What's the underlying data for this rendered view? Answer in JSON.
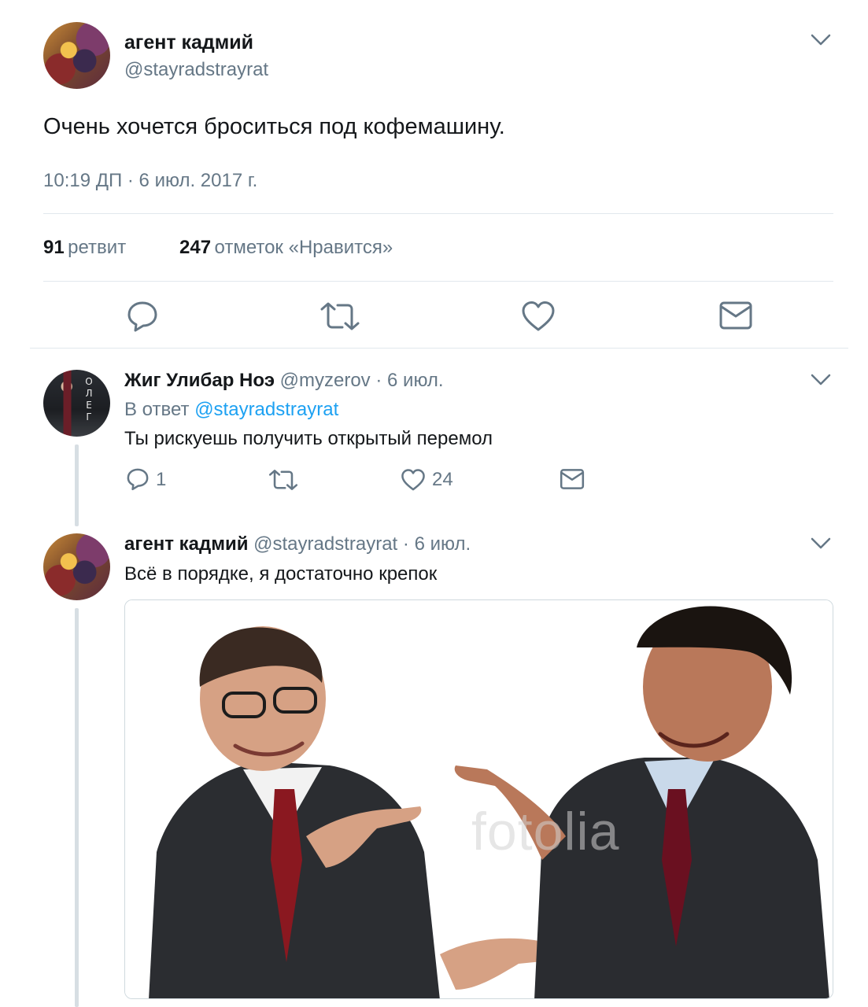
{
  "main_tweet": {
    "author_name": "агент кадмий",
    "author_handle": "@stayradstrayrat",
    "text": "Очень хочется броситься под кофемашину.",
    "timestamp": "10:19 ДП · 6 июл. 2017 г.",
    "retweets_count": "91",
    "retweets_label": "ретвит",
    "likes_count": "247",
    "likes_label": "отметок «Нравится»"
  },
  "reply": {
    "author_name": "Жиг Улибар Ноэ",
    "author_handle": "@myzerov",
    "date": "· 6 июл.",
    "reply_to_prefix": "В ответ",
    "reply_to_handle": "@stayradstrayrat",
    "text": "Ты рискуешь получить открытый перемол",
    "reply_count": "1",
    "like_count": "24",
    "avatar_letters": [
      "О",
      "Л",
      "Е",
      "Г"
    ]
  },
  "second_reply": {
    "author_name": "агент кадмий",
    "author_handle": "@stayradstrayrat",
    "date": "· 6 июл.",
    "text": "Всё в порядке, я достаточно крепок",
    "image_watermark": "fotolia"
  },
  "colors": {
    "text_primary": "#14171a",
    "text_secondary": "#657786",
    "link": "#1da1f2",
    "divider": "#e1e8ed",
    "icon": "#657786"
  },
  "icons": {
    "menu": "chevron-down-icon",
    "reply": "reply-icon",
    "retweet": "retweet-icon",
    "like": "heart-icon",
    "message": "envelope-icon"
  }
}
